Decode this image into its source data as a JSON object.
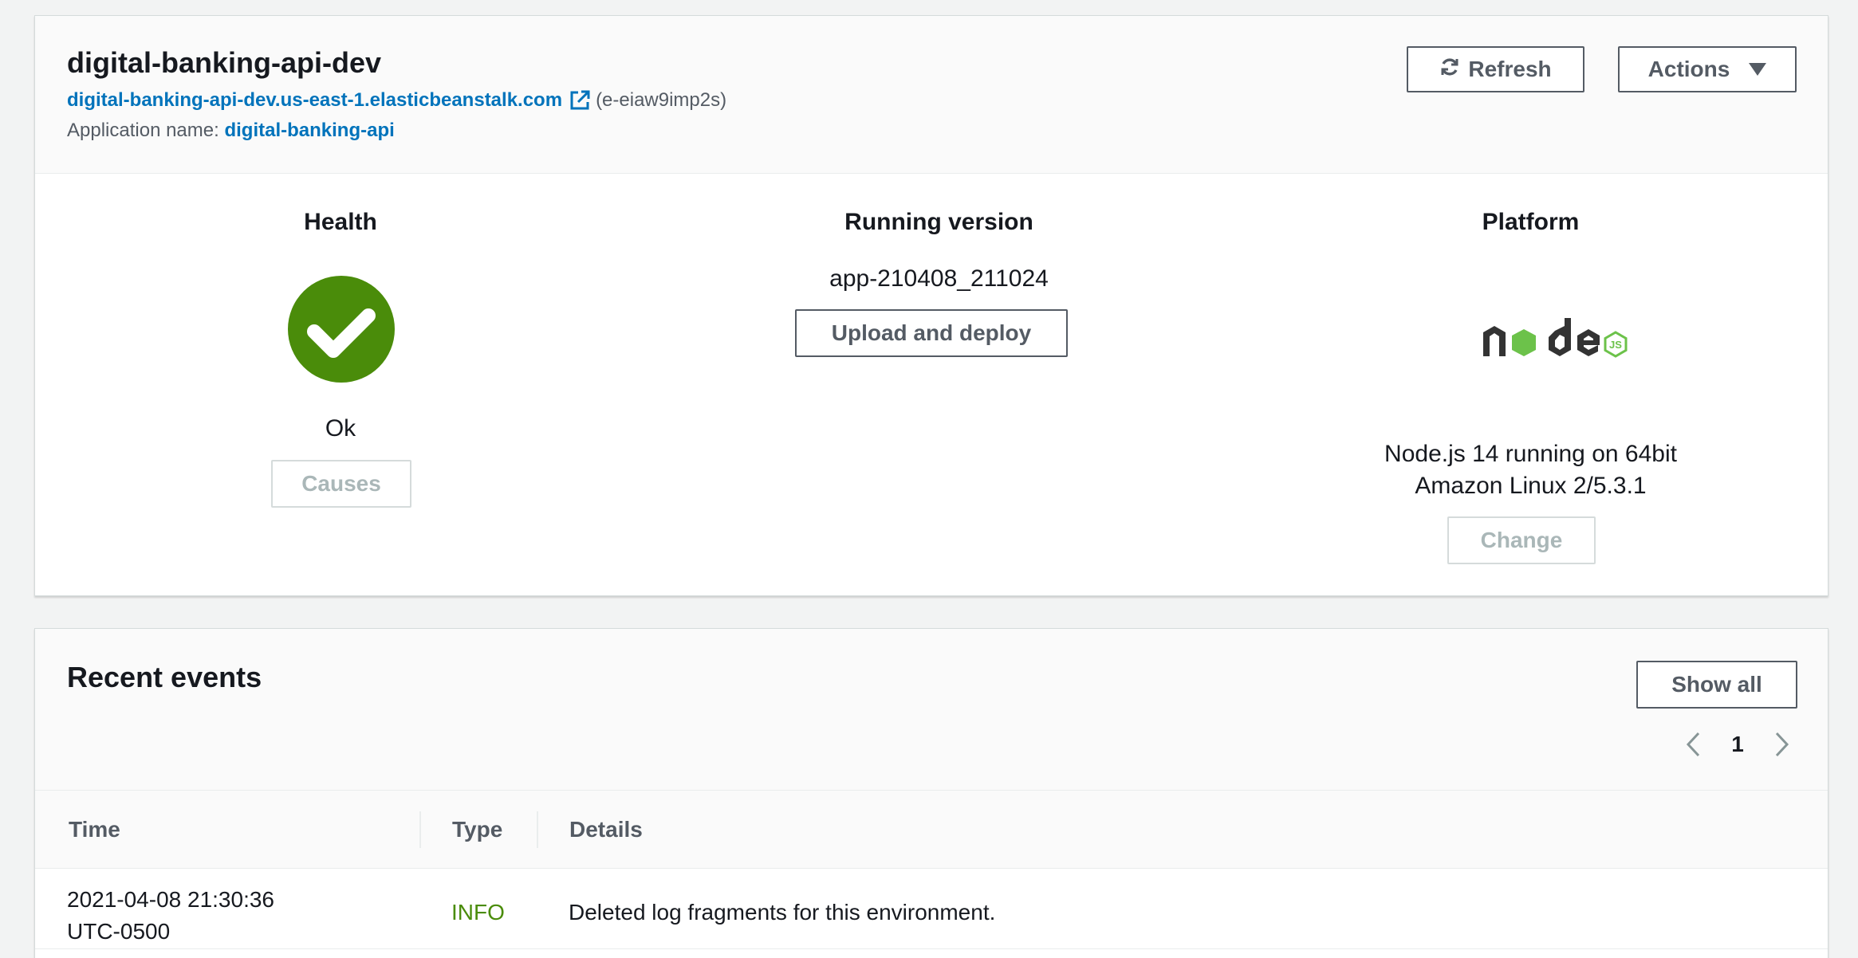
{
  "environment": {
    "name": "digital-banking-api-dev",
    "url": "digital-banking-api-dev.us-east-1.elasticbeanstalk.com",
    "env_id": "(e-eiaw9imp2s)",
    "app_label": "Application name:",
    "app_name": "digital-banking-api",
    "refresh_label": "Refresh",
    "actions_label": "Actions"
  },
  "health": {
    "title": "Health",
    "status": "Ok",
    "causes_label": "Causes",
    "status_color": "#4a8c0a"
  },
  "running_version": {
    "title": "Running version",
    "version": "app-210408_211024",
    "upload_label": "Upload and deploy"
  },
  "platform": {
    "title": "Platform",
    "line1": "Node.js 14 running on 64bit",
    "line2": "Amazon Linux 2/5.3.1",
    "change_label": "Change",
    "logo_icon": "nodejs-logo"
  },
  "events": {
    "title": "Recent events",
    "show_all_label": "Show all",
    "page": "1",
    "columns": [
      "Time",
      "Type",
      "Details"
    ],
    "rows": [
      {
        "time_line1": "2021-04-08 21:30:36",
        "time_line2": "UTC-0500",
        "type": "INFO",
        "details": "Deleted log fragments for this environment."
      }
    ]
  },
  "colors": {
    "link": "#0073bb",
    "ok_green": "#4a8c0a",
    "button_border": "#545b64"
  }
}
